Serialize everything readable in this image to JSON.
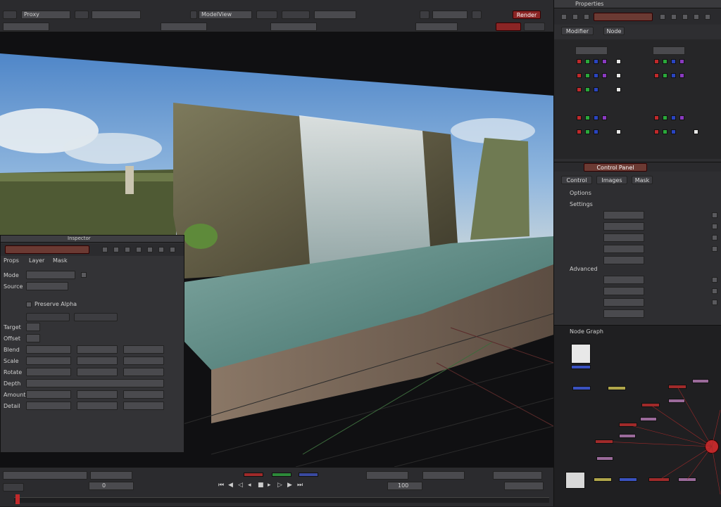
{
  "colors": {
    "accent_red": "#c0292b",
    "panel_bg": "#333336",
    "viewport_bg": "#101012"
  },
  "top_toolbar": {
    "layer_label": "Proxy",
    "view_label": "ModelView",
    "render_label": "Render"
  },
  "properties": {
    "title": "Properties",
    "tabs": [
      "Modifier",
      "Node"
    ],
    "section_title": "Control Panel",
    "options_title": "Options",
    "tabs2": [
      "Control",
      "Images",
      "Mask"
    ],
    "group1": "Settings",
    "group2": "Advanced",
    "node_graph_title": "Node Graph"
  },
  "floating": {
    "title": "Inspector",
    "tabs": [
      "Props",
      "Layer",
      "Mask"
    ],
    "rows": [
      "Mode",
      "Source",
      "Target",
      "Offset",
      "Blend",
      "Scale",
      "Rotate",
      "Depth",
      "Amount",
      "Detail"
    ],
    "checkbox_label": "Preserve Alpha"
  },
  "timeline": {
    "frame": "0",
    "end_frame": "100"
  }
}
